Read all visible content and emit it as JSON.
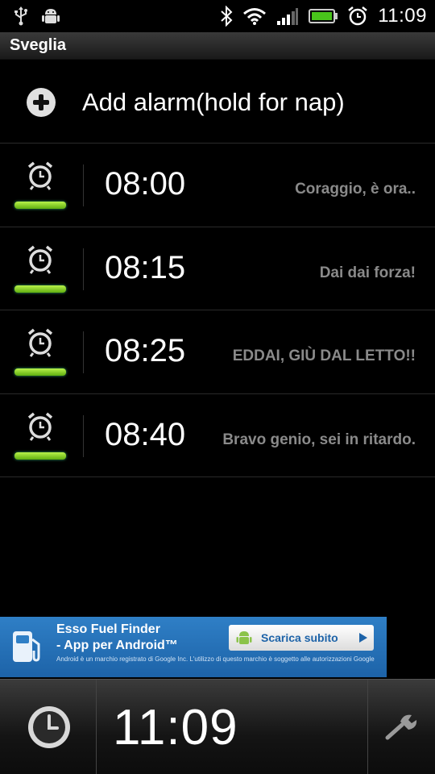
{
  "status": {
    "time": "11:09",
    "icons": [
      "usb-icon",
      "android-debug-icon",
      "bluetooth-icon",
      "wifi-icon",
      "signal-icon",
      "battery-icon",
      "alarm-icon"
    ]
  },
  "app": {
    "title": "Sveglia"
  },
  "add_alarm": {
    "label": "Add alarm(hold for nap)",
    "icon": "plus-circle-icon"
  },
  "alarms": [
    {
      "time": "08:00",
      "label": "Coraggio, è ora..",
      "enabled": true
    },
    {
      "time": "08:15",
      "label": "Dai dai forza!",
      "enabled": true
    },
    {
      "time": "08:25",
      "label": "EDDAI, GIÙ DAL LETTO!!",
      "enabled": true
    },
    {
      "time": "08:40",
      "label": "Bravo genio,  sei in ritardo.",
      "enabled": true
    }
  ],
  "ad": {
    "title_line1": "Esso Fuel Finder",
    "title_line2": "- App per Android™",
    "fine_print": "Android è un marchio registrato di Google Inc. L'utilizzo di questo marchio è soggetto alle autorizzazioni Google",
    "button_label": "Scarica subito"
  },
  "bottom": {
    "time": "11:09"
  },
  "colors": {
    "accent_green": "#7dd321",
    "ad_blue": "#1d63a8"
  }
}
